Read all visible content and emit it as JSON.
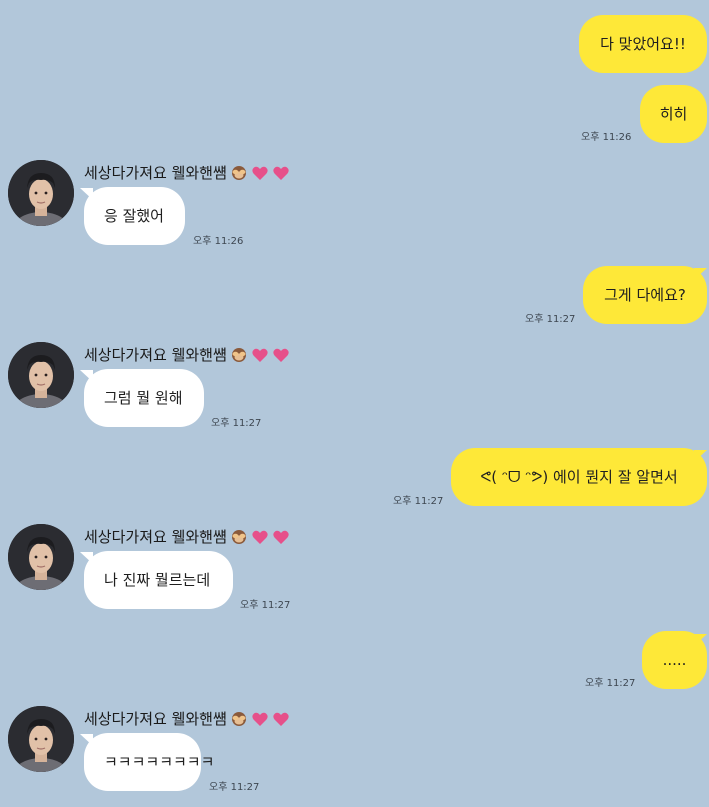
{
  "colors": {
    "background": "#b2c7da",
    "my_bubble": "#fee838",
    "other_bubble": "#ffffff",
    "heart": "#e6508a"
  },
  "contact": {
    "name": "세상다가져요 웰와핸썜",
    "emoji_icons": [
      "see-no-evil-monkey-icon",
      "heart-icon",
      "heart-icon"
    ]
  },
  "messages": [
    {
      "from": "me",
      "text": "다 맞았어요!!"
    },
    {
      "from": "me",
      "text": "히히",
      "time": "오후 11:26"
    },
    {
      "from": "other",
      "text": "응 잘했어",
      "time": "오후 11:26"
    },
    {
      "from": "me",
      "text": "그게 다에요?",
      "time": "오후 11:27"
    },
    {
      "from": "other",
      "text": "그럼 뭘 원해",
      "time": "오후 11:27"
    },
    {
      "from": "me",
      "text": "ᕙ( ᵔᗜ ᵔᕗ) 에이 뭔지 잘 알면서",
      "time": "오후 11:27"
    },
    {
      "from": "other",
      "text": "나 진짜 뭘르는데",
      "time": "오후 11:27"
    },
    {
      "from": "me",
      "text": ".....",
      "time": "오후 11:27"
    },
    {
      "from": "other",
      "text": "ㅋㅋㅋㅋㅋㅋㅋㅋ",
      "time": "오후 11:27"
    }
  ]
}
